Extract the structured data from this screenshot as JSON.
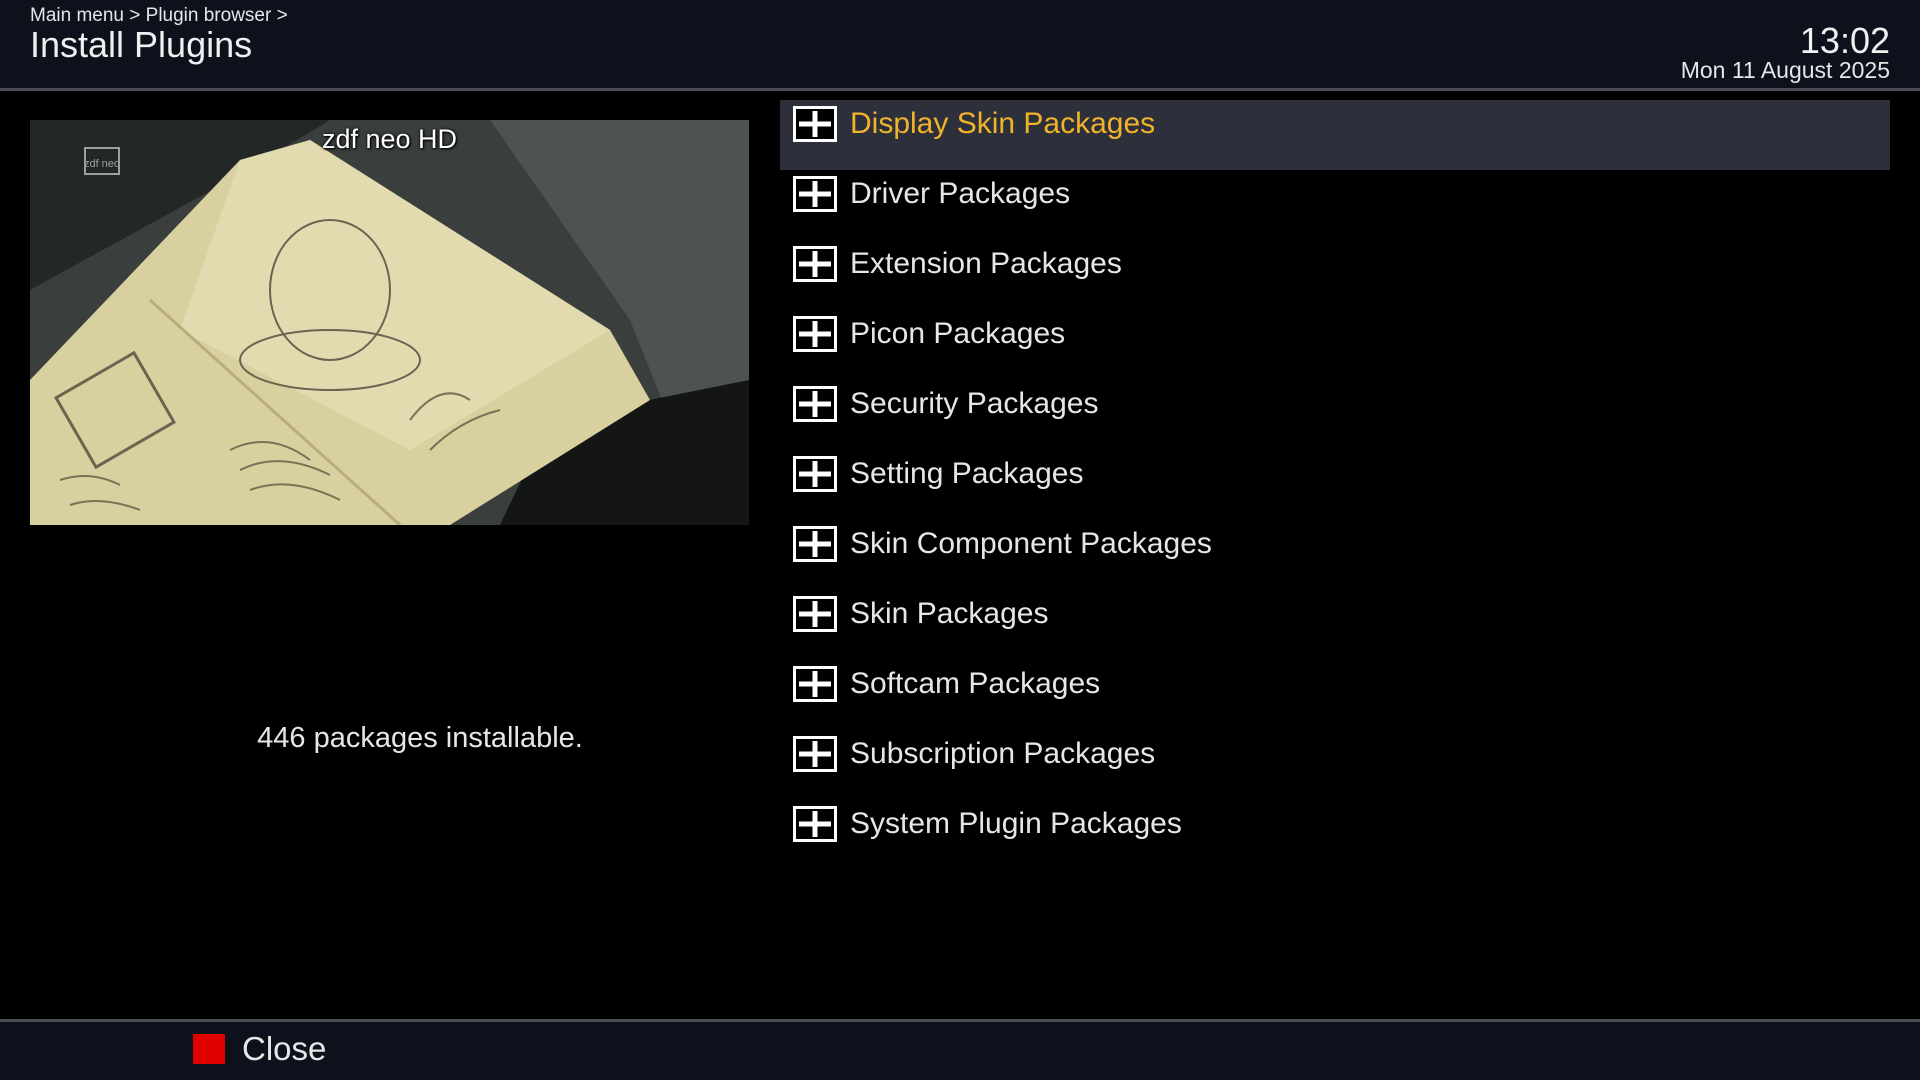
{
  "header": {
    "breadcrumb": "Main menu > Plugin browser >",
    "title": "Install Plugins",
    "time": "13:02",
    "date": "Mon 11 August 2025"
  },
  "preview": {
    "channel": "zdf neo HD",
    "logo_text": "zdf neo"
  },
  "status": {
    "text": "446 packages installable."
  },
  "categories": [
    {
      "label": "Display Skin Packages",
      "selected": true,
      "icon": "plus-box-icon"
    },
    {
      "label": "Driver Packages",
      "selected": false,
      "icon": "plus-box-icon"
    },
    {
      "label": "Extension Packages",
      "selected": false,
      "icon": "plus-box-icon"
    },
    {
      "label": "Picon Packages",
      "selected": false,
      "icon": "plus-box-icon"
    },
    {
      "label": "Security Packages",
      "selected": false,
      "icon": "plus-box-icon"
    },
    {
      "label": "Setting Packages",
      "selected": false,
      "icon": "plus-box-icon"
    },
    {
      "label": "Skin Component Packages",
      "selected": false,
      "icon": "plus-box-icon"
    },
    {
      "label": "Skin Packages",
      "selected": false,
      "icon": "plus-box-icon"
    },
    {
      "label": "Softcam Packages",
      "selected": false,
      "icon": "plus-box-icon"
    },
    {
      "label": "Subscription Packages",
      "selected": false,
      "icon": "plus-box-icon"
    },
    {
      "label": "System Plugin Packages",
      "selected": false,
      "icon": "plus-box-icon"
    }
  ],
  "footer": {
    "red_key_label": "Close"
  },
  "colors": {
    "selected_text": "#f0b428",
    "selected_row": "#2d2f3b",
    "red_key": "#e00000",
    "header_bg": "#0d111b"
  }
}
